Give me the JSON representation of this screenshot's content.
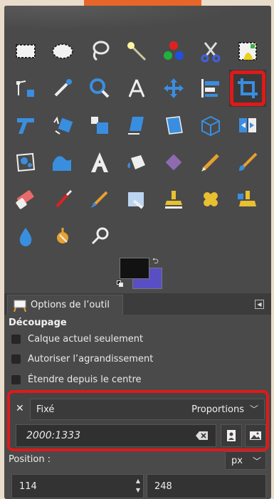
{
  "toolbox": {
    "tools": [
      {
        "name": "rect-select-tool"
      },
      {
        "name": "ellipse-select-tool"
      },
      {
        "name": "free-select-tool"
      },
      {
        "name": "fuzzy-select-tool"
      },
      {
        "name": "select-by-color-tool"
      },
      {
        "name": "scissors-select-tool"
      },
      {
        "name": "foreground-select-tool"
      },
      {
        "name": "paths-tool"
      },
      {
        "name": "color-picker-tool"
      },
      {
        "name": "zoom-tool"
      },
      {
        "name": "measure-tool"
      },
      {
        "name": "move-tool"
      },
      {
        "name": "align-tool"
      },
      {
        "name": "crop-tool",
        "active": true
      },
      {
        "name": "rotate-tool"
      },
      {
        "name": "scale-tool"
      },
      {
        "name": "shear-tool"
      },
      {
        "name": "perspective-tool"
      },
      {
        "name": "unified-transform-tool"
      },
      {
        "name": "handle-transform-tool"
      },
      {
        "name": "flip-tool"
      },
      {
        "name": "cage-transform-tool"
      },
      {
        "name": "warp-transform-tool"
      },
      {
        "name": "text-tool"
      },
      {
        "name": "bucket-fill-tool"
      },
      {
        "name": "blend-tool"
      },
      {
        "name": "pencil-tool"
      },
      {
        "name": "paintbrush-tool"
      },
      {
        "name": "eraser-tool"
      },
      {
        "name": "airbrush-tool"
      },
      {
        "name": "ink-tool"
      },
      {
        "name": "mypaint-brush-tool"
      },
      {
        "name": "clone-tool"
      },
      {
        "name": "heal-tool"
      },
      {
        "name": "perspective-clone-tool"
      },
      {
        "name": "blur-sharpen-tool"
      },
      {
        "name": "smudge-tool"
      },
      {
        "name": "dodge-burn-tool"
      }
    ]
  },
  "colors": {
    "foreground": "#121212",
    "background": "#5a4ec4",
    "accent": "#e01919"
  },
  "options": {
    "tab_label": "Options de l’outil",
    "section_title": "Découpage",
    "current_layer_only": "Calque actuel seulement",
    "allow_growing": "Autoriser l’agrandissement",
    "expand_from_center": "Étendre depuis le centre",
    "fixed_label": "Fixé",
    "fixed_mode": "Proportions",
    "ratio_value": "2000:1333",
    "position_label": "Position :",
    "unit": "px",
    "position_x": "114",
    "position_y": "248"
  }
}
